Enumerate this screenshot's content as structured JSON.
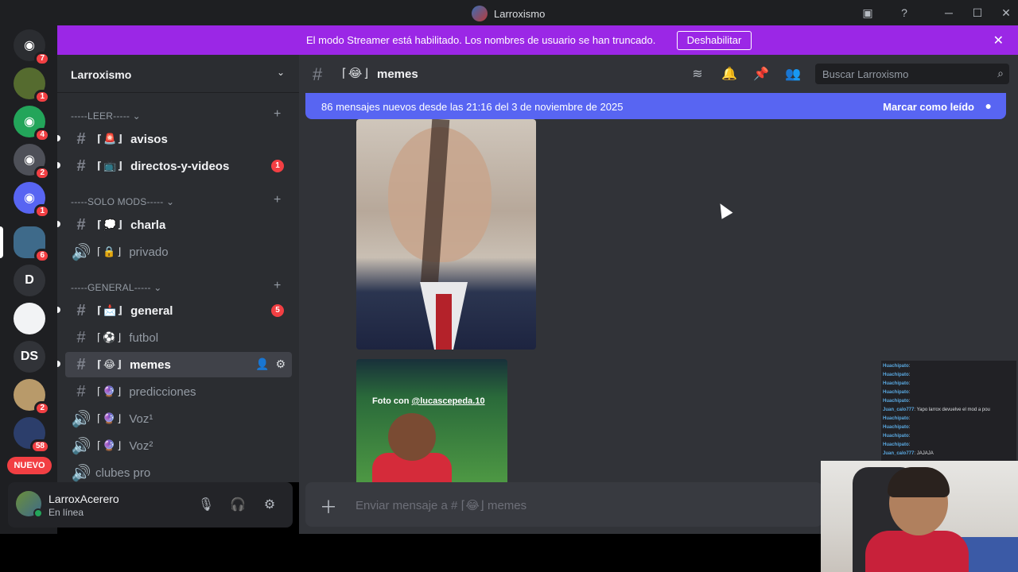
{
  "titlebar": {
    "title": "Larroxismo"
  },
  "rail": {
    "servers": [
      {
        "initials": "",
        "badge": "7",
        "color": "#2b2d31"
      },
      {
        "initials": "",
        "badge": "1",
        "color": "#556b2f"
      },
      {
        "initials": "",
        "badge": "4",
        "color": "#23a55a"
      },
      {
        "initials": "",
        "badge": "2",
        "color": "#4e5058"
      },
      {
        "initials": "",
        "badge": "1",
        "color": "#5865f2"
      },
      {
        "initials": "",
        "badge": "6",
        "color": "#3e6a8a"
      },
      {
        "initials": "D",
        "badge": "",
        "color": "#313338"
      },
      {
        "initials": "",
        "badge": "",
        "color": "#f2f3f5"
      },
      {
        "initials": "DS",
        "badge": "",
        "color": "#313338"
      },
      {
        "initials": "",
        "badge": "2",
        "color": "#b89a6a"
      },
      {
        "initials": "",
        "badge": "58",
        "color": "#2c3e6b"
      }
    ],
    "new_label": "NUEVO"
  },
  "banner": {
    "text": "El modo Streamer está habilitado. Los nombres de usuario se han truncado.",
    "button": "Deshabilitar"
  },
  "sidebar": {
    "guild_name": "Larroxismo",
    "categories": [
      {
        "label": "-----LEER-----"
      },
      {
        "label": "-----SOLO MODS-----"
      },
      {
        "label": "-----GENERAL-----"
      }
    ],
    "channels": [
      {
        "emoji": "🚨",
        "name": "avisos",
        "badge": ""
      },
      {
        "emoji": "📺",
        "name": "directos-y-videos",
        "badge": "1"
      },
      {
        "emoji": "💭",
        "name": "charla",
        "badge": ""
      },
      {
        "emoji": "🔒",
        "name": "privado",
        "badge": ""
      },
      {
        "emoji": "📩",
        "name": "general",
        "badge": "5"
      },
      {
        "emoji": "⚽",
        "name": "futbol",
        "badge": ""
      },
      {
        "emoji": "😂",
        "name": "memes",
        "badge": ""
      },
      {
        "emoji": "🔮",
        "name": "predicciones",
        "badge": ""
      },
      {
        "emoji": "🔮",
        "name": "Voz¹",
        "badge": ""
      },
      {
        "emoji": "🔮",
        "name": "Voz²",
        "badge": ""
      },
      {
        "emoji": "",
        "name": "clubes pro",
        "badge": ""
      }
    ]
  },
  "user": {
    "name": "LarroxAcerero",
    "status": "En línea"
  },
  "channel": {
    "emoji": "😂",
    "name": "memes",
    "search_placeholder": "Buscar Larroxismo"
  },
  "newbar": {
    "message": "86 mensajes nuevos desde las 21:16 del 3 de noviembre de 2025",
    "mark": "Marcar como leído"
  },
  "messages": {
    "image2_caption_prefix": "Foto con ",
    "image2_caption_handle": "@lucascepeda.10"
  },
  "composer": {
    "placeholder": "Enviar mensaje a # ⌈😂⌋ memes"
  },
  "stream_chat": [
    {
      "user": "Huachipato",
      "text": ":"
    },
    {
      "user": "Huachipato",
      "text": ":"
    },
    {
      "user": "Huachipato",
      "text": ":"
    },
    {
      "user": "Huachipato",
      "text": ":"
    },
    {
      "user": "Huachipato",
      "text": ":"
    },
    {
      "user": "Juan_calo777",
      "text": ": Yapo larrox devuelve el mod a pou"
    },
    {
      "user": "Huachipato",
      "text": ":"
    },
    {
      "user": "Huachipato",
      "text": ":"
    },
    {
      "user": "Huachipato",
      "text": ":"
    },
    {
      "user": "Huachipato",
      "text": ":"
    },
    {
      "user": "Juan_calo777",
      "text": ": JAJAJA"
    }
  ]
}
